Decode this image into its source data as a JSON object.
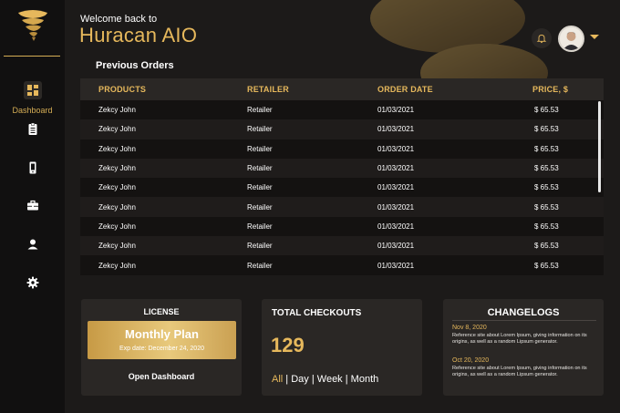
{
  "sidebar": {
    "active_label": "Dashboard",
    "items": [
      {
        "icon": "dashboard-icon",
        "label": "Dashboard",
        "active": true
      },
      {
        "icon": "clipboard-icon"
      },
      {
        "icon": "mobile-icon"
      },
      {
        "icon": "briefcase-icon"
      },
      {
        "icon": "user-icon"
      },
      {
        "icon": "gear-icon"
      }
    ]
  },
  "header": {
    "welcome": "Welcome back to",
    "brand": "Huracan AIO"
  },
  "orders": {
    "title": "Previous Orders",
    "columns": [
      "PRODUCTS",
      "RETAILER",
      "ORDER DATE",
      "PRICE, $"
    ],
    "rows": [
      [
        "Zekcy John",
        "Retailer",
        "01/03/2021",
        "$ 65.53"
      ],
      [
        "Zekcy John",
        "Retailer",
        "01/03/2021",
        "$ 65.53"
      ],
      [
        "Zekcy John",
        "Retailer",
        "01/03/2021",
        "$ 65.53"
      ],
      [
        "Zekcy John",
        "Retailer",
        "01/03/2021",
        "$ 65.53"
      ],
      [
        "Zekcy John",
        "Retailer",
        "01/03/2021",
        "$ 65.53"
      ],
      [
        "Zekcy John",
        "Retailer",
        "01/03/2021",
        "$ 65.53"
      ],
      [
        "Zekcy John",
        "Retailer",
        "01/03/2021",
        "$ 65.53"
      ],
      [
        "Zekcy John",
        "Retailer",
        "01/03/2021",
        "$ 65.53"
      ],
      [
        "Zekcy John",
        "Retailer",
        "01/03/2021",
        "$ 65.53"
      ]
    ]
  },
  "license": {
    "title": "LICENSE",
    "plan": "Monthly Plan",
    "exp": "Exp date: December 24, 2020",
    "open_label": "Open Dashboard"
  },
  "checkouts": {
    "title": "TOTAL CHECKOUTS",
    "value": "129",
    "filters": [
      "All",
      "Day",
      "Week",
      "Month"
    ],
    "active_filter": "All"
  },
  "changelogs": {
    "title": "CHANGELOGS",
    "entries": [
      {
        "date": "Nov 8, 2020",
        "text": "Reference site about Lorem Ipsum, giving information on its origins, as well as a random Lipsum generator."
      },
      {
        "date": "Oct 20, 2020",
        "text": "Reference site about Lorem Ipsum, giving information on its origins, as well as a random Lipsum generator."
      }
    ]
  },
  "colors": {
    "accent": "#e6b85c",
    "background": "#1c1a19",
    "sidebar": "#111010",
    "card": "#2a2725"
  }
}
